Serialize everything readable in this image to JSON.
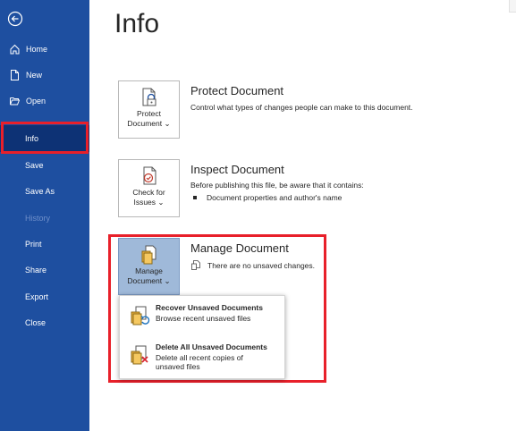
{
  "sidebar": {
    "items": [
      {
        "label": "Home",
        "icon": "home-icon"
      },
      {
        "label": "New",
        "icon": "new-document-icon"
      },
      {
        "label": "Open",
        "icon": "folder-open-icon"
      },
      {
        "label": "Info"
      },
      {
        "label": "Save"
      },
      {
        "label": "Save As"
      },
      {
        "label": "History"
      },
      {
        "label": "Print"
      },
      {
        "label": "Share"
      },
      {
        "label": "Export"
      },
      {
        "label": "Close"
      }
    ]
  },
  "page": {
    "title": "Info"
  },
  "protect": {
    "tile_line1": "Protect",
    "tile_line2": "Document",
    "chevron": "⌄",
    "title": "Protect Document",
    "desc": "Control what types of changes people can make to this document."
  },
  "inspect": {
    "tile_line1": "Check for",
    "tile_line2": "Issues",
    "chevron": "⌄",
    "title": "Inspect Document",
    "desc": "Before publishing this file, be aware that it contains:",
    "bullets": [
      "Document properties and author's name"
    ]
  },
  "manage": {
    "tile_line1": "Manage",
    "tile_line2": "Document",
    "chevron": "⌄",
    "title": "Manage Document",
    "status": "There are no unsaved changes.",
    "menu": [
      {
        "title": "Recover Unsaved Documents",
        "desc": "Browse recent unsaved files"
      },
      {
        "title": "Delete All Unsaved Documents",
        "desc": "Delete all recent copies of unsaved files"
      }
    ]
  },
  "colors": {
    "sidebar_bg": "#1e4fa0",
    "sidebar_active": "#0d3275",
    "highlight": "#e8202a",
    "selected_tile": "#9fb9d9"
  }
}
